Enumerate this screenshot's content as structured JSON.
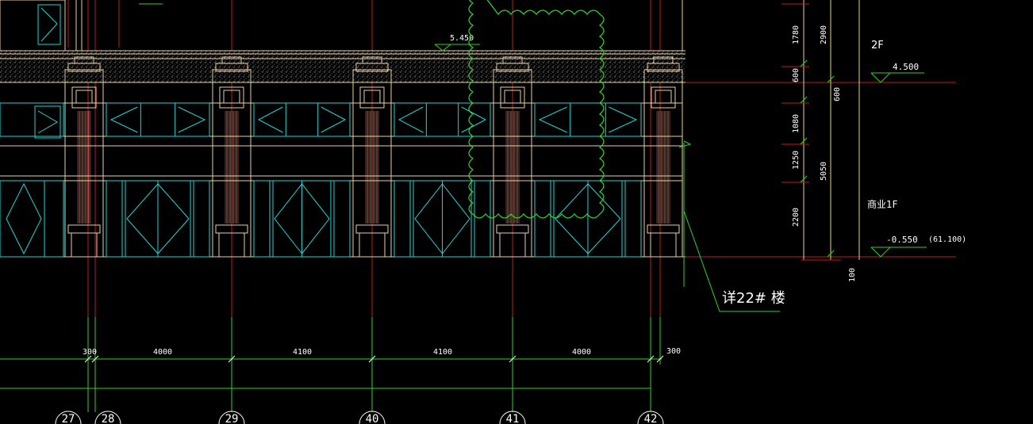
{
  "drawing": {
    "levels": {
      "elev_545": "5.450",
      "floor_2f": "2F",
      "elev_4500": "4.500",
      "floor_1f": "商业1F",
      "elev_neg0550": "-0.550",
      "elev_abs": "(61.100)"
    },
    "vertical_dims": {
      "d1780": "1780",
      "d2900": "2900",
      "d600a": "600",
      "d600b": "600",
      "d1080": "1080",
      "d1250": "1250",
      "d5050": "5050",
      "d2200": "2200",
      "d100": "100"
    },
    "horizontal_dims": {
      "h300a": "300",
      "h4000": "4000",
      "h4100a": "4100",
      "h4100b": "4100",
      "h4000b": "4000",
      "h300b": "300"
    },
    "note": "详22# 楼",
    "grid_labels": [
      "27",
      "28",
      "29",
      "40",
      "41",
      "42"
    ],
    "colors": {
      "window": "#19d9d9",
      "wall": "#e8d2a0",
      "axis": "#c41a1a",
      "dim": "#2ad42a",
      "text": "#ffffff",
      "cloud": "#2bdc2b"
    }
  }
}
